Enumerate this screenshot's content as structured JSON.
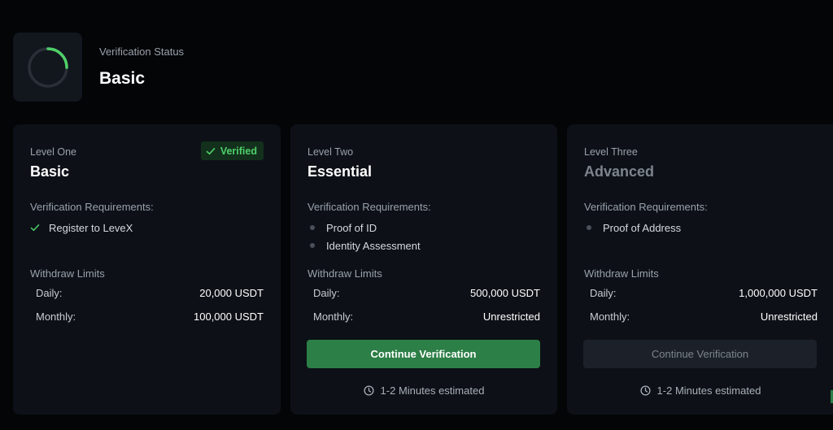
{
  "status": {
    "label": "Verification Status",
    "value": "Basic",
    "icon": "progress-ring-icon",
    "ring_color": "#4fd06a",
    "progress": 0.25
  },
  "colors": {
    "accent_green": "#2c7f46",
    "verified_text": "#4fd06a",
    "card_bg": "#0d1117",
    "page_bg": "#030507"
  },
  "cards": [
    {
      "level_label": "Level One",
      "level_name": "Basic",
      "badge": "Verified",
      "badge_icon": "check-icon",
      "requirements_title": "Verification Requirements:",
      "requirements": [
        {
          "label": "Register to LeveX",
          "icon": "check-icon"
        }
      ],
      "limits_title": "Withdraw Limits",
      "daily_label": "Daily:",
      "daily_value": "20,000 USDT",
      "monthly_label": "Monthly:",
      "monthly_value": "100,000 USDT"
    },
    {
      "level_label": "Level Two",
      "level_name": "Essential",
      "requirements_title": "Verification Requirements:",
      "requirements": [
        {
          "label": "Proof of ID",
          "icon": "bullet-dot-icon"
        },
        {
          "label": "Identity Assessment",
          "icon": "bullet-dot-icon"
        }
      ],
      "limits_title": "Withdraw Limits",
      "daily_label": "Daily:",
      "daily_value": "500,000 USDT",
      "monthly_label": "Monthly:",
      "monthly_value": "Unrestricted",
      "button_label": "Continue Verification",
      "estimate": "1-2 Minutes estimated",
      "estimate_icon": "clock-icon"
    },
    {
      "level_label": "Level Three",
      "level_name": "Advanced",
      "requirements_title": "Verification Requirements:",
      "requirements": [
        {
          "label": "Proof of Address",
          "icon": "bullet-dot-icon"
        }
      ],
      "limits_title": "Withdraw Limits",
      "daily_label": "Daily:",
      "daily_value": "1,000,000 USDT",
      "monthly_label": "Monthly:",
      "monthly_value": "Unrestricted",
      "button_label": "Continue Verification",
      "estimate": "1-2 Minutes estimated",
      "estimate_icon": "clock-icon"
    }
  ]
}
